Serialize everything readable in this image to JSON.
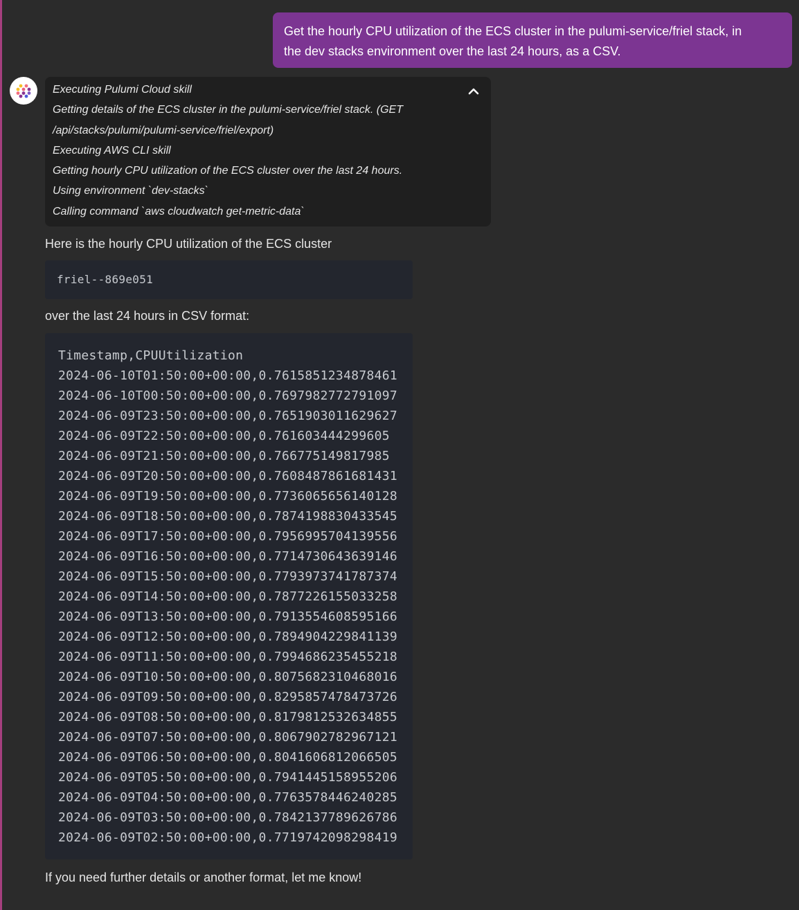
{
  "user_message": {
    "line1": "Get the hourly CPU utilization of the ECS cluster in the pulumi-service/friel stack, in",
    "line2": "the dev stacks environment over the last 24 hours, as a CSV."
  },
  "assistant": {
    "avatar_icon": "pulumi-logo-icon",
    "skill_steps": [
      "Executing Pulumi Cloud skill",
      "Getting details of the ECS cluster in the pulumi-service/friel stack. (GET",
      "/api/stacks/pulumi/pulumi-service/friel/export)",
      "Executing AWS CLI skill",
      "Getting hourly CPU utilization of the ECS cluster over the last 24 hours.",
      "Using environment `dev-stacks`",
      "Calling command `aws cloudwatch get-metric-data`"
    ],
    "collapse_icon": "chevron-up-icon",
    "intro_text": "Here is the hourly CPU utilization of the ECS cluster",
    "cluster_name": "friel--869e051",
    "format_text": "over the last 24 hours in CSV format:",
    "csv_lines": [
      "Timestamp,CPUUtilization",
      "2024-06-10T01:50:00+00:00,0.7615851234878461",
      "2024-06-10T00:50:00+00:00,0.7697982772791097",
      "2024-06-09T23:50:00+00:00,0.7651903011629627",
      "2024-06-09T22:50:00+00:00,0.761603444299605",
      "2024-06-09T21:50:00+00:00,0.766775149817985",
      "2024-06-09T20:50:00+00:00,0.7608487861681431",
      "2024-06-09T19:50:00+00:00,0.7736065656140128",
      "2024-06-09T18:50:00+00:00,0.7874198830433545",
      "2024-06-09T17:50:00+00:00,0.7956995704139556",
      "2024-06-09T16:50:00+00:00,0.7714730643639146",
      "2024-06-09T15:50:00+00:00,0.7793973741787374",
      "2024-06-09T14:50:00+00:00,0.7877226155033258",
      "2024-06-09T13:50:00+00:00,0.7913554608595166",
      "2024-06-09T12:50:00+00:00,0.7894904229841139",
      "2024-06-09T11:50:00+00:00,0.7994686235455218",
      "2024-06-09T10:50:00+00:00,0.8075682310468016",
      "2024-06-09T09:50:00+00:00,0.8295857478473726",
      "2024-06-09T08:50:00+00:00,0.8179812532634855",
      "2024-06-09T07:50:00+00:00,0.8067902782967121",
      "2024-06-09T06:50:00+00:00,0.8041606812066505",
      "2024-06-09T05:50:00+00:00,0.7941445158955206",
      "2024-06-09T04:50:00+00:00,0.7763578446240285",
      "2024-06-09T03:50:00+00:00,0.7842137789626786",
      "2024-06-09T02:50:00+00:00,0.7719742098298419"
    ],
    "closing_text": "If you need further details or another format, let me know!"
  },
  "colors": {
    "background": "#2b2b2b",
    "user_bubble": "#7c3592",
    "left_rail": "#a53f7e",
    "skill_panel": "#1f1f1f",
    "code_block": "#23262e"
  }
}
